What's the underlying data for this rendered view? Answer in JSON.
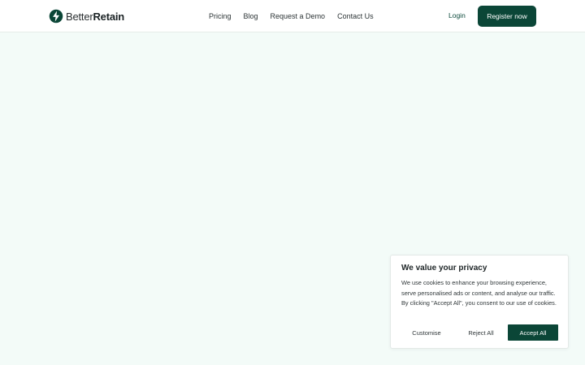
{
  "brand": {
    "name_light": "Better",
    "name_bold": "Retain",
    "logo_icon": "lightning-bolt-circle-icon",
    "primary_color": "#0b4637"
  },
  "nav": {
    "items": [
      {
        "label": "Pricing"
      },
      {
        "label": "Blog"
      },
      {
        "label": "Request a Demo"
      },
      {
        "label": "Contact Us"
      }
    ],
    "login_label": "Login",
    "register_label": "Register now"
  },
  "cookie_banner": {
    "title": "We value your privacy",
    "body": "We use cookies to enhance your browsing experience, serve personalised ads or content, and analyse our traffic. By clicking \"Accept All\", you consent to our use of cookies.",
    "customise_label": "Customise",
    "reject_label": "Reject All",
    "accept_label": "Accept All"
  },
  "page": {
    "background_color": "#f3fbf8"
  }
}
